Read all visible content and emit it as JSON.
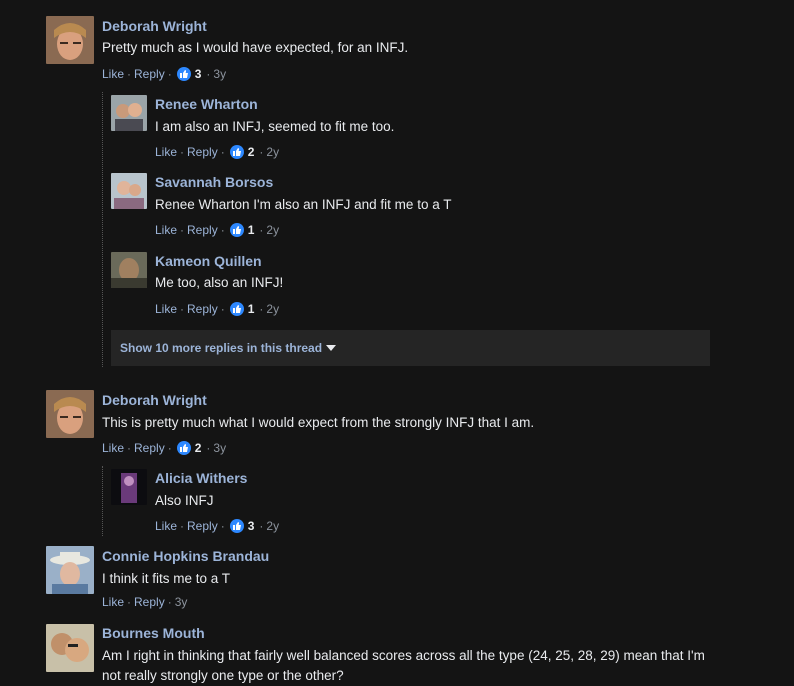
{
  "comments": [
    {
      "name": "Deborah Wright",
      "text": "Pretty much as I would have expected, for an INFJ.",
      "like": "Like",
      "reply": "Reply",
      "count": "3",
      "age": "3y"
    },
    {
      "name": "Renee Wharton",
      "text": "I am also an INFJ, seemed to fit me too.",
      "like": "Like",
      "reply": "Reply",
      "count": "2",
      "age": "2y"
    },
    {
      "name": "Savannah Borsos",
      "text": "Renee Wharton I'm also an INFJ and fit me to a T",
      "like": "Like",
      "reply": "Reply",
      "count": "1",
      "age": "2y"
    },
    {
      "name": "Kameon Quillen",
      "text": "Me too, also an INFJ!",
      "like": "Like",
      "reply": "Reply",
      "count": "1",
      "age": "2y"
    },
    {
      "name": "Deborah Wright",
      "text": "This is pretty much what I would expect from the strongly INFJ that I am.",
      "like": "Like",
      "reply": "Reply",
      "count": "2",
      "age": "3y"
    },
    {
      "name": "Alicia Withers",
      "text": "Also INFJ",
      "like": "Like",
      "reply": "Reply",
      "count": "3",
      "age": "2y"
    },
    {
      "name": "Connie Hopkins Brandau",
      "text": "I think it fits me to a T",
      "like": "Like",
      "reply": "Reply",
      "age": "3y"
    },
    {
      "name": "Bournes Mouth",
      "text": "Am I right in thinking that fairly well balanced scores across all the type (24, 25, 28, 29) mean that I'm not really strongly one type or the other?"
    }
  ],
  "show_more": "Show 10 more replies in this thread",
  "colors": {
    "background": "#141414",
    "link": "#9cb4d8",
    "like_badge": "#2d88ff",
    "more_box": "#252525"
  },
  "icons": {
    "like": "thumbs-up-icon",
    "expand": "caret-down-icon"
  }
}
